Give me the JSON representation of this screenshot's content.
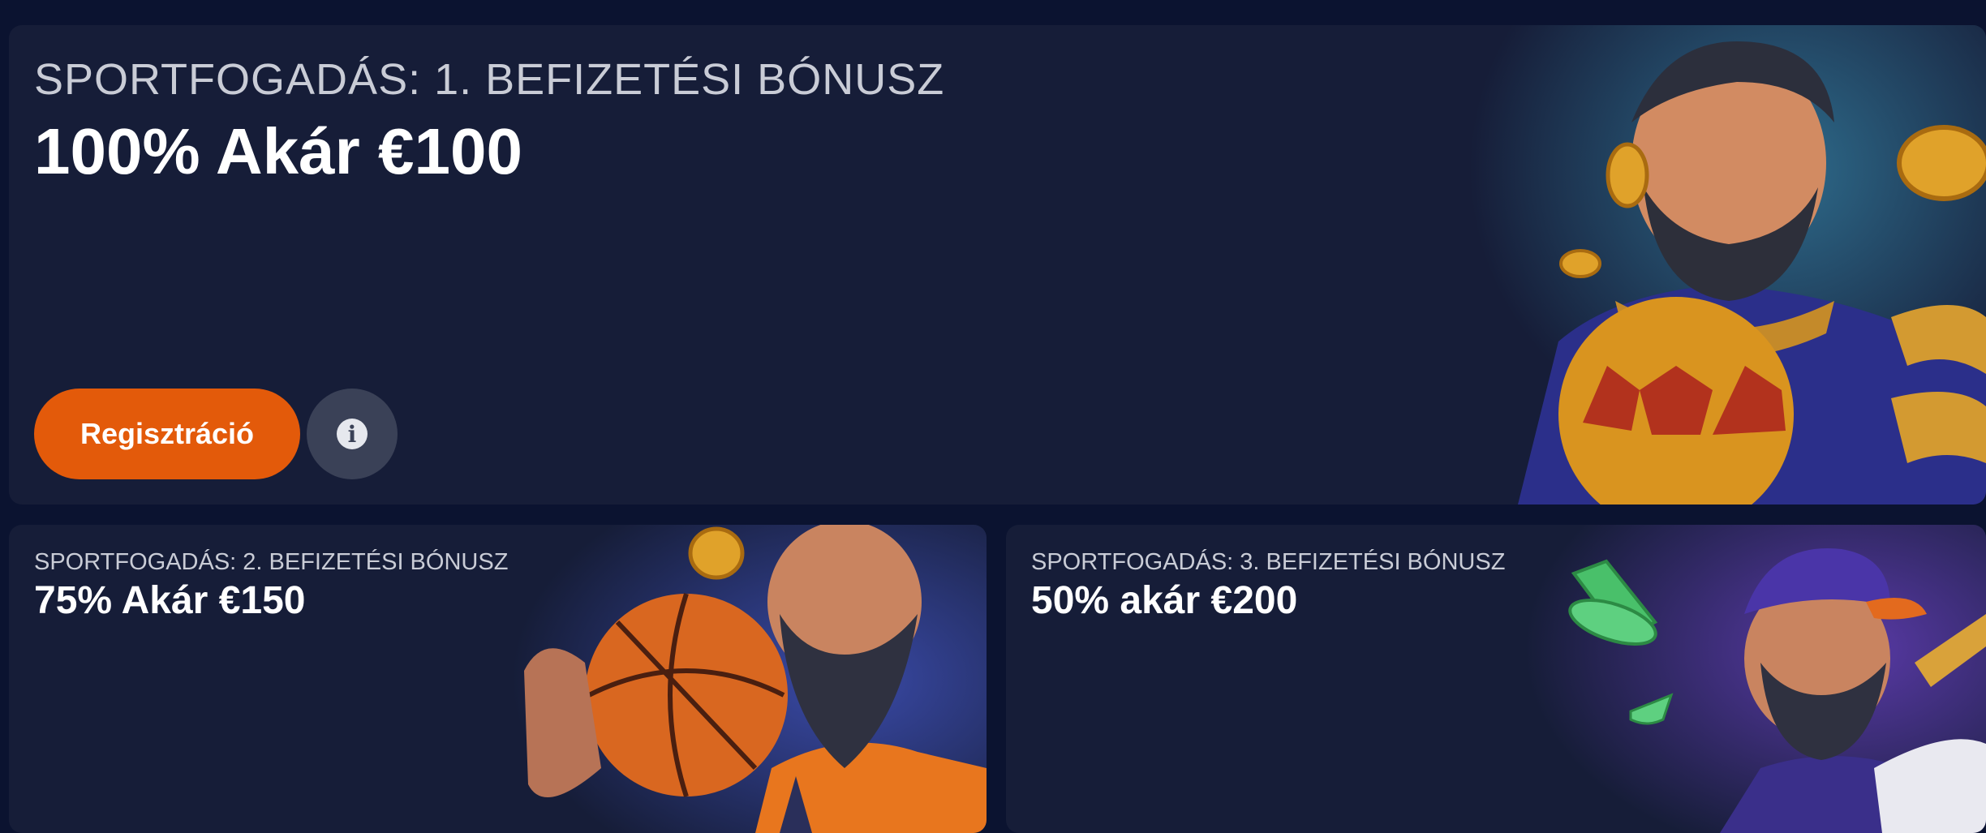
{
  "bonuses": [
    {
      "subtitle": "SPORTFOGADÁS: 1. BEFIZETÉSI BÓNUSZ",
      "title": "100% Akár €100",
      "register_label": "Regisztráció",
      "info_icon": "info-icon"
    },
    {
      "subtitle": "SPORTFOGADÁS: 2. BEFIZETÉSI BÓNUSZ",
      "title": "75% Akár €150"
    },
    {
      "subtitle": "SPORTFOGADÁS: 3. BEFIZETÉSI BÓNUSZ",
      "title": "50% akár €200"
    }
  ],
  "colors": {
    "background": "#0b1330",
    "card": "#161d38",
    "accent": "#e35a0a",
    "info_button": "#3a4157"
  }
}
